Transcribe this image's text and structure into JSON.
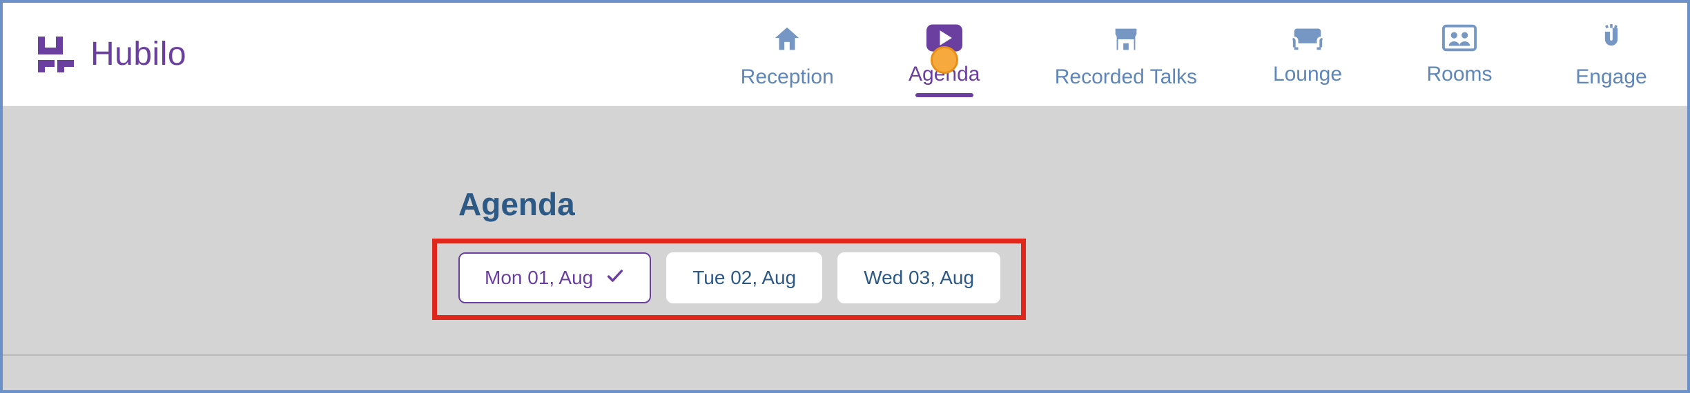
{
  "brand": {
    "name": "Hubilo"
  },
  "nav": {
    "items": [
      {
        "label": "Reception",
        "icon": "home",
        "active": false
      },
      {
        "label": "Agenda",
        "icon": "video",
        "active": true
      },
      {
        "label": "Recorded Talks",
        "icon": "store",
        "active": false
      },
      {
        "label": "Lounge",
        "icon": "sofa",
        "active": false
      },
      {
        "label": "Rooms",
        "icon": "people",
        "active": false
      },
      {
        "label": "Engage",
        "icon": "magnet",
        "active": false
      }
    ]
  },
  "page": {
    "title": "Agenda"
  },
  "dates": [
    {
      "label": "Mon 01, Aug",
      "selected": true
    },
    {
      "label": "Tue 02, Aug",
      "selected": false
    },
    {
      "label": "Wed 03, Aug",
      "selected": false
    }
  ],
  "annotations": {
    "highlight_box": true,
    "cursor_on_nav_index": 1
  },
  "colors": {
    "brand_purple": "#6b3fa0",
    "nav_blue": "#5f86b9",
    "content_bg": "#d4d4d4",
    "highlight_red": "#e1261c",
    "cursor_orange": "#f6a93d"
  }
}
